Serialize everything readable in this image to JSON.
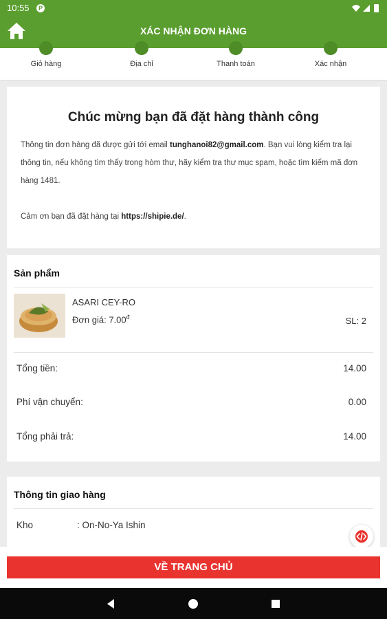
{
  "status_bar": {
    "time": "10:55",
    "app_icon": "P",
    "icons": [
      "wifi-icon",
      "signal-icon",
      "battery-icon"
    ]
  },
  "app_bar": {
    "title": "XÁC NHẬN ĐƠN HÀNG",
    "home_icon": "home-icon"
  },
  "stepper": {
    "steps": [
      {
        "label": "Giỏ hàng"
      },
      {
        "label": "Địa chỉ"
      },
      {
        "label": "Thanh toán"
      },
      {
        "label": "Xác nhận"
      }
    ]
  },
  "success": {
    "heading": "Chúc mừng bạn đã đặt hàng thành công",
    "line1_prefix": "Thông tin đơn hàng đã được gửi tới email ",
    "email": "tunghanoi82@gmail.com",
    "line1_suffix": ". Bạn vui lòng kiểm tra lại thông tin, nếu không tìm thấy trong hòm thư, hãy kiểm tra thư mục spam, hoặc tìm kiếm mã đơn hàng 1481.",
    "thanks_prefix": "Cảm ơn bạn đã đặt hàng tại ",
    "site": "https://shipie.de/",
    "thanks_suffix": "."
  },
  "products": {
    "title": "Sản phẩm",
    "items": [
      {
        "name": "ASARI CEY-RO",
        "price_label": "Đơn giá: ",
        "price": "7.00",
        "currency": "đ",
        "qty": "SL: 2"
      }
    ],
    "summary": [
      {
        "label": "Tổng tiền:",
        "value": "14.00"
      },
      {
        "label": "Phí vận chuyển:",
        "value": "0.00"
      },
      {
        "label": "Tổng phải trả:",
        "value": "14.00"
      }
    ]
  },
  "shipping": {
    "title": "Thông tin giao hàng",
    "rows": [
      {
        "label": "Kho",
        "value": ": On-No-Ya Ishin"
      }
    ]
  },
  "cta": {
    "label": "VỀ TRANG CHỦ"
  },
  "nav": {
    "buttons": [
      "back-icon",
      "home-circle-icon",
      "recents-icon"
    ]
  },
  "colors": {
    "primary_green": "#5a9e2f",
    "step_dot": "#4e8c27",
    "cta_red": "#e8332f",
    "fab_accent": "#e8332f"
  }
}
